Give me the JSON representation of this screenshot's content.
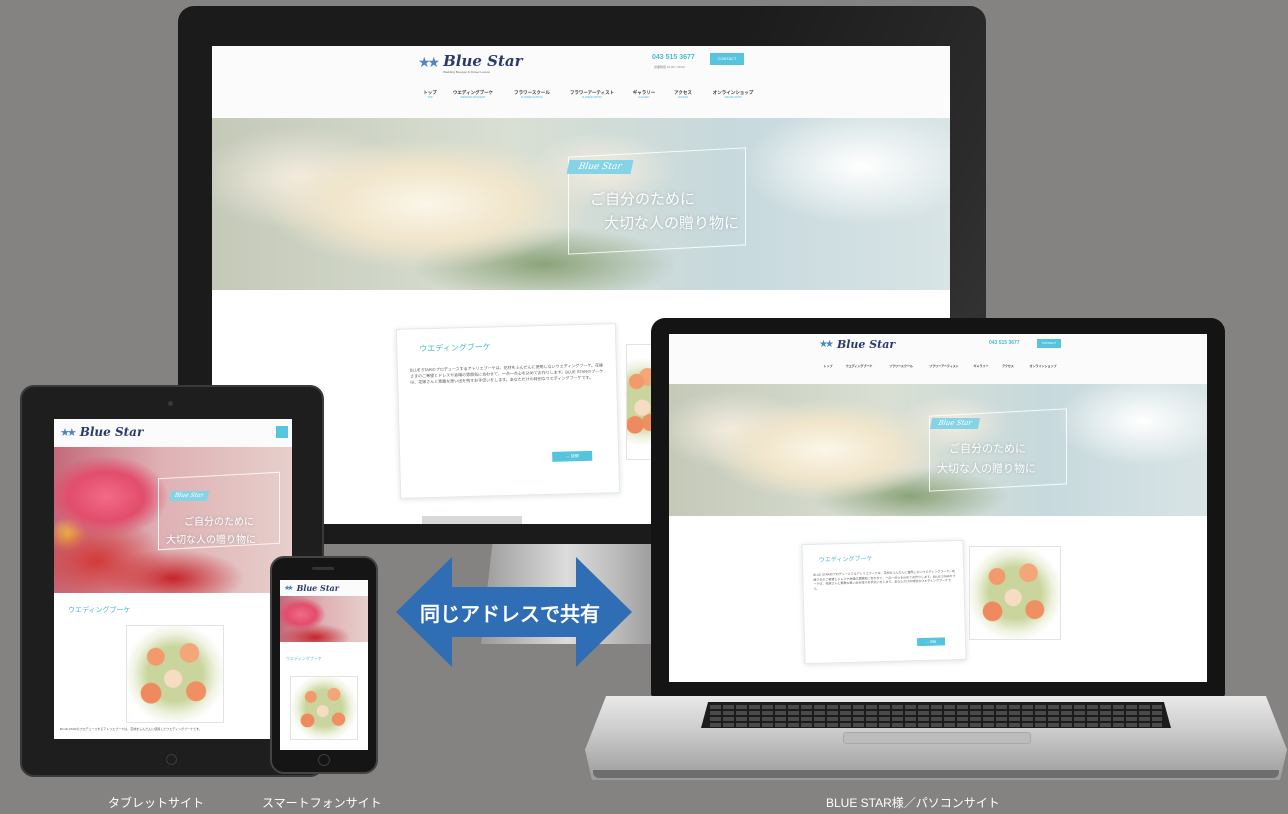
{
  "colors": {
    "background": "#858282",
    "accent": "#57c4dd",
    "arrow": "#2f6db4"
  },
  "site": {
    "logo": "Blue Star",
    "logo_sub": "Wedding Bouquet & Flower Lesson",
    "phone": "043 515 3677",
    "phone_hours": "営業時間 10:00〜18:00",
    "contact": "CONTACT",
    "nav": [
      {
        "jp": "トップ",
        "en": "TOP"
      },
      {
        "jp": "ウエディングブーケ",
        "en": "WEDDING BOUQUET"
      },
      {
        "jp": "フラワースクール",
        "en": "FLOWER SCHOOL"
      },
      {
        "jp": "フラワーアーティスト",
        "en": "FLOWER ARTIST"
      },
      {
        "jp": "ギャラリー",
        "en": "GALLERY"
      },
      {
        "jp": "アクセス",
        "en": "ACCESS"
      },
      {
        "jp": "オンラインショップ",
        "en": "ONLINE SHOP"
      }
    ],
    "hero_tag": "Blue Star",
    "hero_line1": "ご自分のために",
    "hero_line2": "大切な人の贈り物に",
    "section_title": "ウエディングブーケ",
    "intro": "BLUE STARのプロデュースするアトリエブーケは、花材をふんだんに使用したウエディングブーケです。",
    "body": "BLUE STARのプロデュースするアトリエブーケは、花材をふんだんに使用しないウエディングブーケ。花嫁さまのご希望とドレスや会場の雰囲気に合わせて、一点一点心を込めてお作りします。BLUE STARのブーケは、花嫁さんと素敵な思い出を残すお手伝いをします。あなただけの特別なウエディングブーケです。",
    "more": "→ 詳細"
  },
  "overlay": {
    "arrow_text": "同じアドレスで共有",
    "caption_tablet": "タブレットサイト",
    "caption_phone": "スマートフォンサイト",
    "caption_pc": "BLUE STAR様／パソコンサイト"
  }
}
